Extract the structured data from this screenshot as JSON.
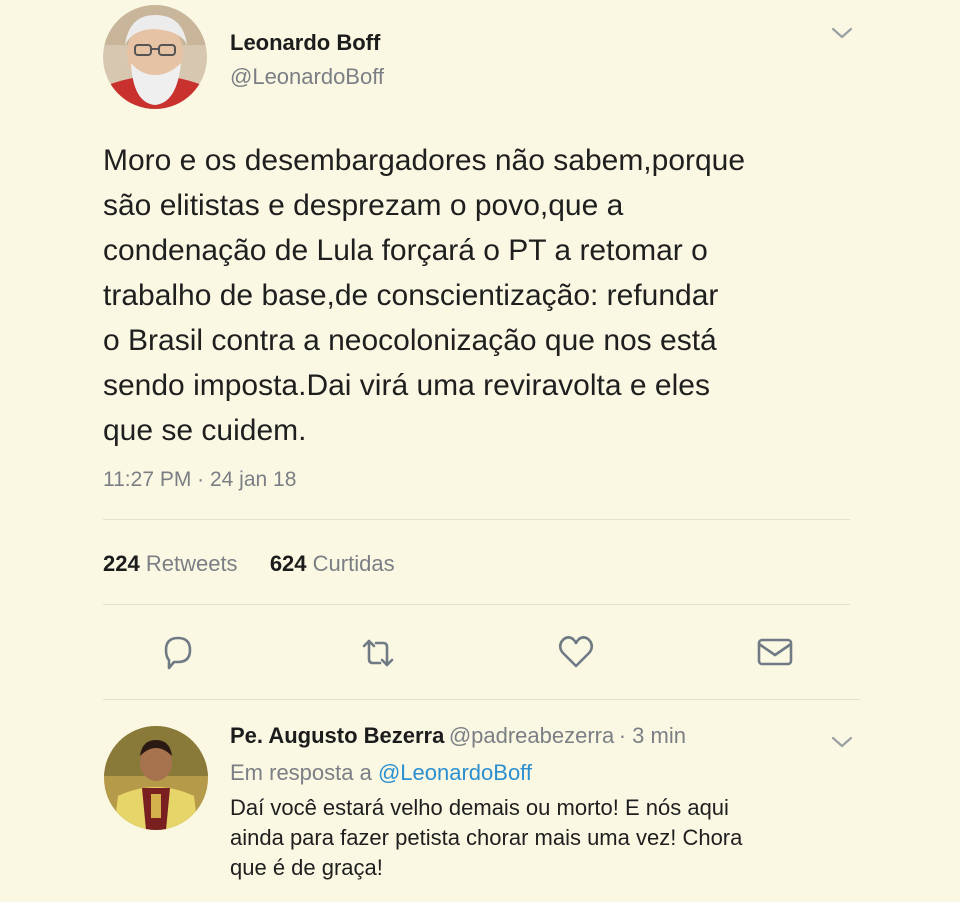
{
  "tweet": {
    "author_name": "Leonardo Boff",
    "author_handle": "@LeonardoBoff",
    "text_lines": [
      "Moro e os desembargadores não sabem,porque",
      "são elitistas e desprezam o povo,que a",
      "condenação de Lula forçará o PT a retomar o",
      "trabalho de base,de conscientização: refundar",
      "o Brasil contra a neocolonização que nos está",
      "sendo imposta.Dai virá uma reviravolta e eles",
      "que se cuidem."
    ],
    "timestamp": "11:27 PM · 24 jan 18",
    "retweets_count": "224",
    "retweets_label": "Retweets",
    "likes_count": "624",
    "likes_label": "Curtidas"
  },
  "actions": {
    "icons": [
      "reply-icon",
      "retweet-icon",
      "like-icon",
      "message-icon"
    ]
  },
  "reply": {
    "author_name": "Pe. Augusto Bezerra",
    "author_handle": "@padreabezerra",
    "time": "· 3 min",
    "reply_prefix": "Em resposta a",
    "reply_mention": "@LeonardoBoff",
    "text_lines": [
      "Daí você estará velho demais ou morto! E nós aqui",
      "ainda para fazer petista chorar mais uma vez! Chora",
      "que é de graça!"
    ]
  },
  "colors": {
    "background": "#faf8e3",
    "link": "#2c8fd0",
    "secondary_text": "#7b7f85",
    "icon": "#6f7a84"
  }
}
